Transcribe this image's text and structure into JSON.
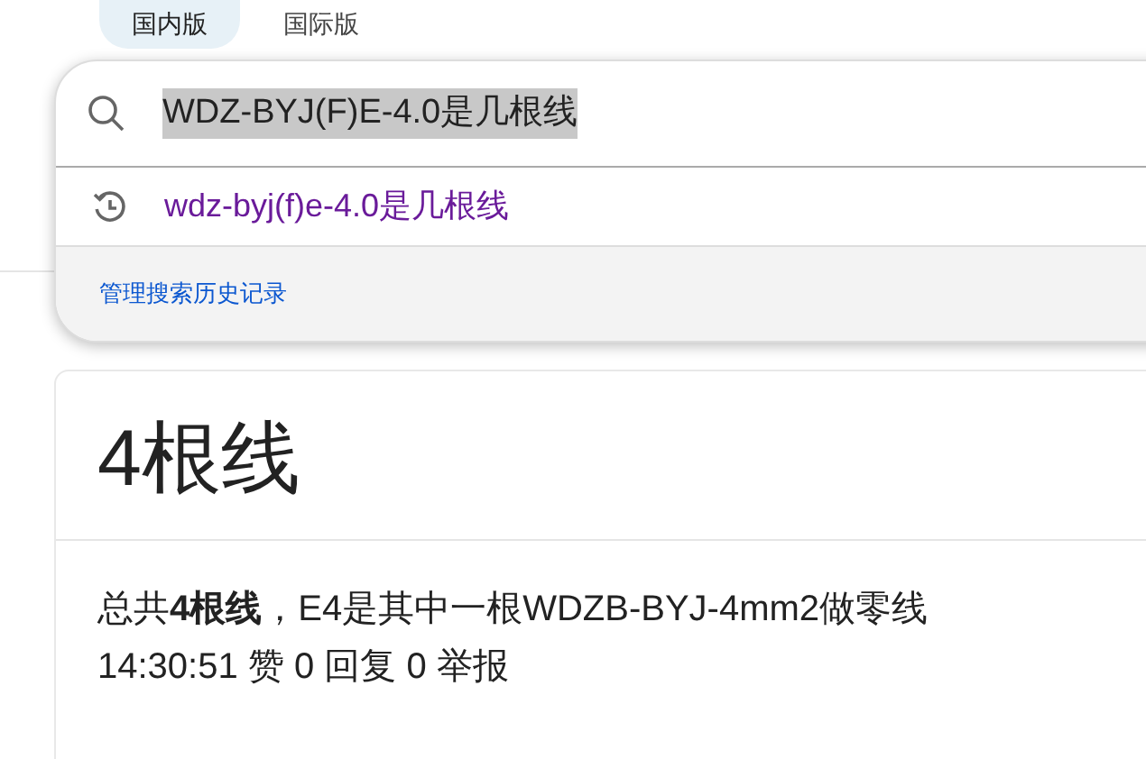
{
  "tabs": [
    {
      "label": "国内版",
      "selected": true
    },
    {
      "label": "国际版",
      "selected": false
    }
  ],
  "search": {
    "value": "WDZ-BYJ(F)E-4.0是几根线",
    "text_selected": true
  },
  "suggestions": [
    {
      "text": "wdz-byj(f)e-4.0是几根线"
    }
  ],
  "manage_history_link": "管理搜索历史记录",
  "answer_card": {
    "title": "4根线",
    "snippet": "总共**4根线**，E4是其中一根WDZB-BYJ-4mm2做零线",
    "meta": "14:30:51 赞 0 回复 0 举报"
  }
}
